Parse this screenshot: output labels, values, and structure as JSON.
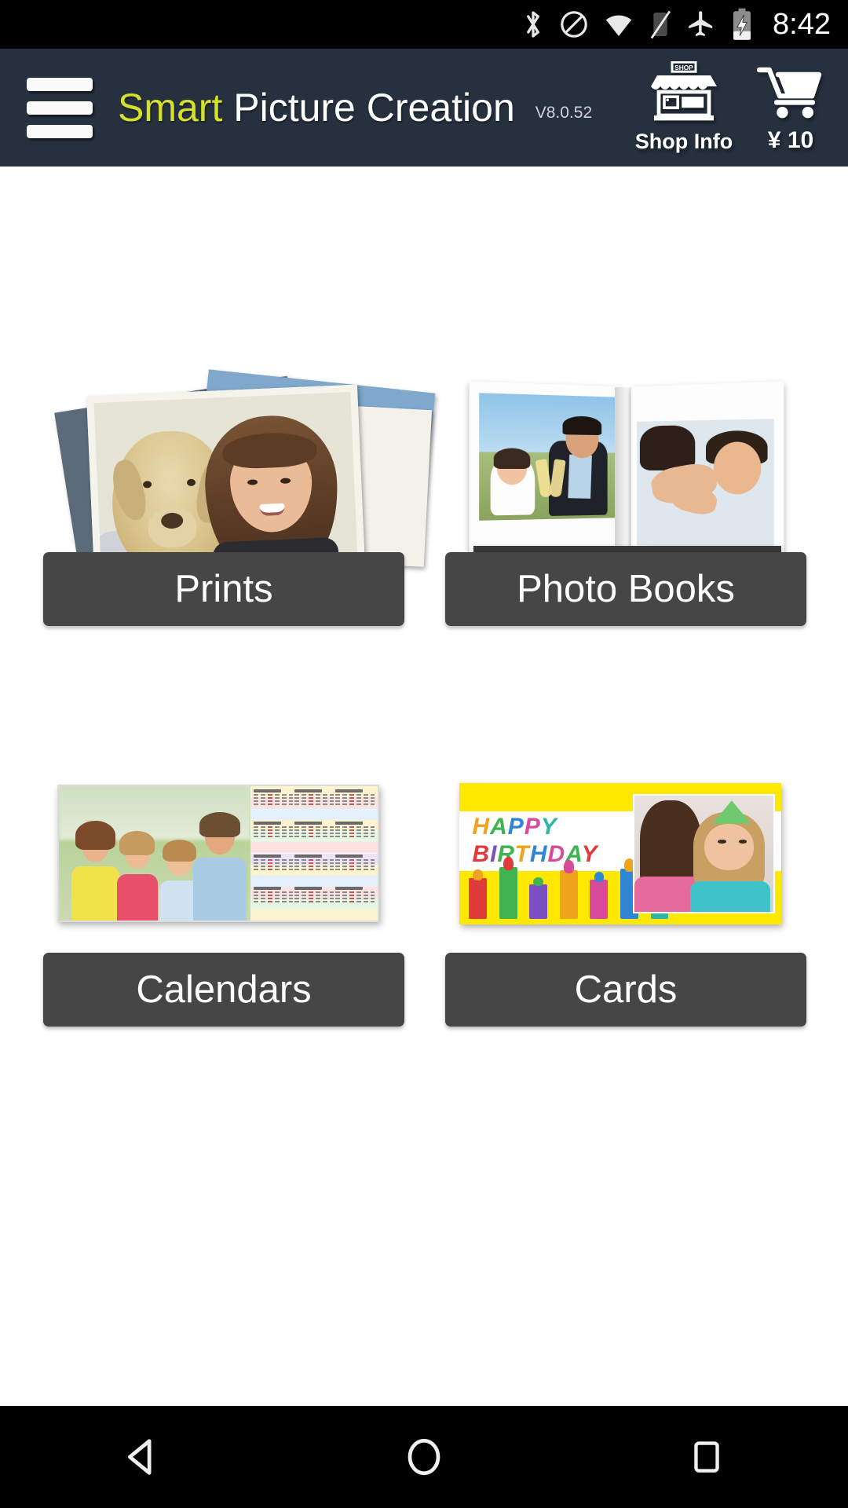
{
  "status_bar": {
    "time": "8:42",
    "icons": [
      {
        "name": "bluetooth-icon"
      },
      {
        "name": "do-not-disturb-icon"
      },
      {
        "name": "wifi-icon"
      },
      {
        "name": "cellular-signal-off-icon"
      },
      {
        "name": "airplane-mode-icon"
      },
      {
        "name": "battery-charging-icon"
      }
    ]
  },
  "header": {
    "menu_icon": "hamburger-menu-icon",
    "title_brand": "Smart",
    "title_rest": " Picture Creation",
    "version": "V8.0.52",
    "shop_info_label": "Shop Info",
    "shop_info_icon": "storefront-icon",
    "shop_sign_text": "SHOP",
    "cart_icon": "shopping-cart-icon",
    "cart_amount": "¥ 10",
    "background_color": "#26303f",
    "brand_color": "#d4e02a"
  },
  "tiles": [
    {
      "id": "prints",
      "label": "Prints",
      "art": "stack-of-photo-prints-girl-with-golden-retriever"
    },
    {
      "id": "photo-books",
      "label": "Photo Books",
      "art": "open-wedding-photo-book-bride-and-groom-toasting"
    },
    {
      "id": "calendars",
      "label": "Calendars",
      "art": "desk-calendar-family-photo-with-twelve-month-grid"
    },
    {
      "id": "cards",
      "label": "Cards",
      "art": "happy-birthday-greeting-card-with-candles-and-girl-photo"
    }
  ],
  "card_art": {
    "line1": "HAPPY",
    "line2": "BIRTHDAY",
    "letter_colors_line1": [
      "#f0a41e",
      "#3fb34f",
      "#2f86d4",
      "#d94a9c",
      "#2fb6a8"
    ],
    "letter_colors_line2": [
      "#e03a3a",
      "#7a4fc0",
      "#3fb34f",
      "#f0a41e",
      "#2f86d4",
      "#d94a9c",
      "#3fb34f",
      "#e03a3a"
    ],
    "candle_colors": [
      "#e03a3a",
      "#3fb34f",
      "#d94a9c",
      "#f0a41e",
      "#7a4fc0",
      "#2f86d4",
      "#2fb6a8"
    ],
    "background_color": "#ffe800"
  },
  "calendar_art": {
    "stripe_colors": [
      "#fdf3d0",
      "#fde2e2",
      "#e4f0fb",
      "#fdf3d0",
      "#e8f6e4",
      "#fde2e2",
      "#ece4f6",
      "#fdf3d0",
      "#e4f0fb",
      "#fde2e2",
      "#e8f6e4",
      "#fdf3d0"
    ],
    "month_count": 12
  },
  "nav_bar": {
    "back_icon": "back-triangle-icon",
    "home_icon": "home-circle-icon",
    "recents_icon": "recents-square-icon"
  },
  "tile_label_color": "#464646",
  "content_background": "#ffffff"
}
